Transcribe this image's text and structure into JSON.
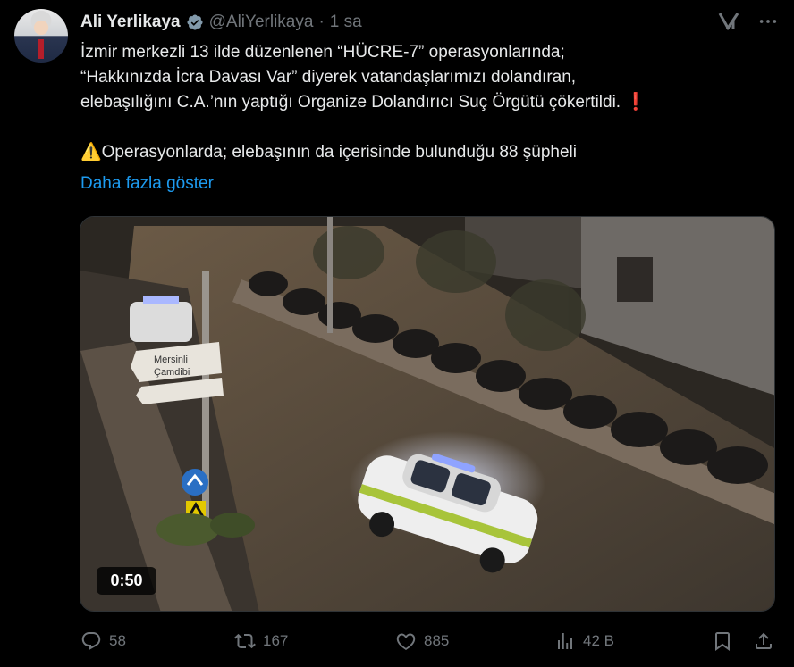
{
  "author": {
    "name": "Ali Yerlikaya",
    "handle": "@AliYerlikaya",
    "separator": "·",
    "time": "1 sa"
  },
  "tweet": {
    "lines": [
      "İzmir merkezli 13 ilde düzenlenen “HÜCRE-7” operasyonlarında;",
      "“Hakkınızda İcra Davası Var” diyerek vatandaşlarımızı dolandıran,",
      "elebaşılığını C.A.’nın yaptığı Organize Dolandırıcı Suç Örgütü çökertildi. ❗",
      "⚠️Operasyonlarda; elebaşının da içerisinde bulunduğu 88 şüpheli"
    ],
    "show_more": "Daha fazla göster"
  },
  "media": {
    "duration": "0:50",
    "sign_line1": "Mersinli",
    "sign_line2": "Çamdibi"
  },
  "actions": {
    "replies": "58",
    "reposts": "167",
    "likes": "885",
    "views": "42 B"
  },
  "colors": {
    "accent": "#1d9bf0",
    "muted": "#71767b",
    "text": "#e7e9ea"
  },
  "icons": [
    "verified-badge-icon",
    "grok-icon",
    "more-options-icon",
    "reply-icon",
    "repost-icon",
    "like-icon",
    "views-icon",
    "bookmark-icon",
    "share-icon"
  ]
}
